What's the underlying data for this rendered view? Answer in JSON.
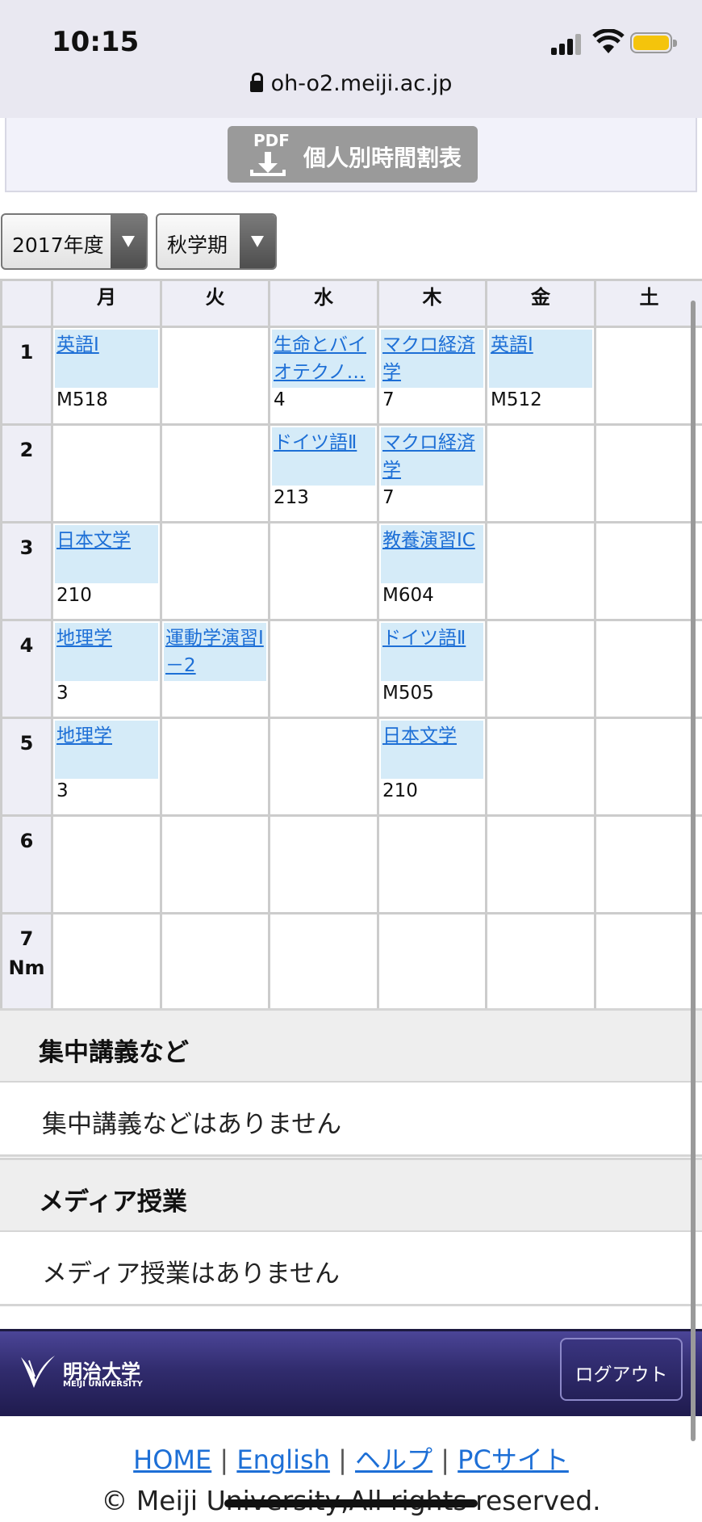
{
  "status": {
    "time": "10:15",
    "url": "oh-o2.meiji.ac.jp"
  },
  "pdf_button": {
    "icon_label": "PDF",
    "label": "個人別時間割表"
  },
  "year_select": {
    "value": "2017年度"
  },
  "term_select": {
    "value": "秋学期"
  },
  "timetable": {
    "days": [
      "月",
      "火",
      "水",
      "木",
      "金",
      "土"
    ],
    "periods": [
      {
        "label": "1",
        "sub": "",
        "cells": [
          {
            "course": "英語Ⅰ",
            "room": "M518"
          },
          null,
          {
            "course": "生命とバイオテクノ…",
            "room": "4"
          },
          {
            "course": "マクロ経済学",
            "room": "7"
          },
          {
            "course": "英語Ⅰ",
            "room": "M512"
          },
          null
        ]
      },
      {
        "label": "2",
        "sub": "",
        "cells": [
          null,
          null,
          {
            "course": "ドイツ語Ⅱ",
            "room": "213"
          },
          {
            "course": "マクロ経済学",
            "room": "7"
          },
          null,
          null
        ]
      },
      {
        "label": "3",
        "sub": "",
        "cells": [
          {
            "course": "日本文学",
            "room": "210"
          },
          null,
          null,
          {
            "course": "教養演習ⅠC",
            "room": "M604"
          },
          null,
          null
        ]
      },
      {
        "label": "4",
        "sub": "",
        "cells": [
          {
            "course": "地理学",
            "room": "3"
          },
          {
            "course": "運動学演習Ⅰ－2",
            "room": ""
          },
          null,
          {
            "course": "ドイツ語Ⅱ",
            "room": "M505"
          },
          null,
          null
        ]
      },
      {
        "label": "5",
        "sub": "",
        "cells": [
          {
            "course": "地理学",
            "room": "3"
          },
          null,
          null,
          {
            "course": "日本文学",
            "room": "210"
          },
          null,
          null
        ]
      },
      {
        "label": "6",
        "sub": "",
        "cells": [
          null,
          null,
          null,
          null,
          null,
          null
        ]
      },
      {
        "label": "7",
        "sub": "Nm",
        "cells": [
          null,
          null,
          null,
          null,
          null,
          null
        ]
      }
    ]
  },
  "intensive": {
    "title": "集中講義など",
    "message": "集中講義などはありません"
  },
  "media": {
    "title": "メディア授業",
    "message": "メディア授業はありません"
  },
  "footer": {
    "logo_jp": "明治大学",
    "logo_en": "MEIJI UNIVERSITY",
    "logout": "ログアウト",
    "links": [
      "HOME",
      "English",
      "ヘルプ",
      "PCサイト"
    ],
    "separator": "|",
    "copyright": "© Meiji University,All rights reserved."
  },
  "colors": {
    "course_bg": "#d5ebf8",
    "link": "#1d6fd6",
    "footer_bg": "#312c6e"
  }
}
